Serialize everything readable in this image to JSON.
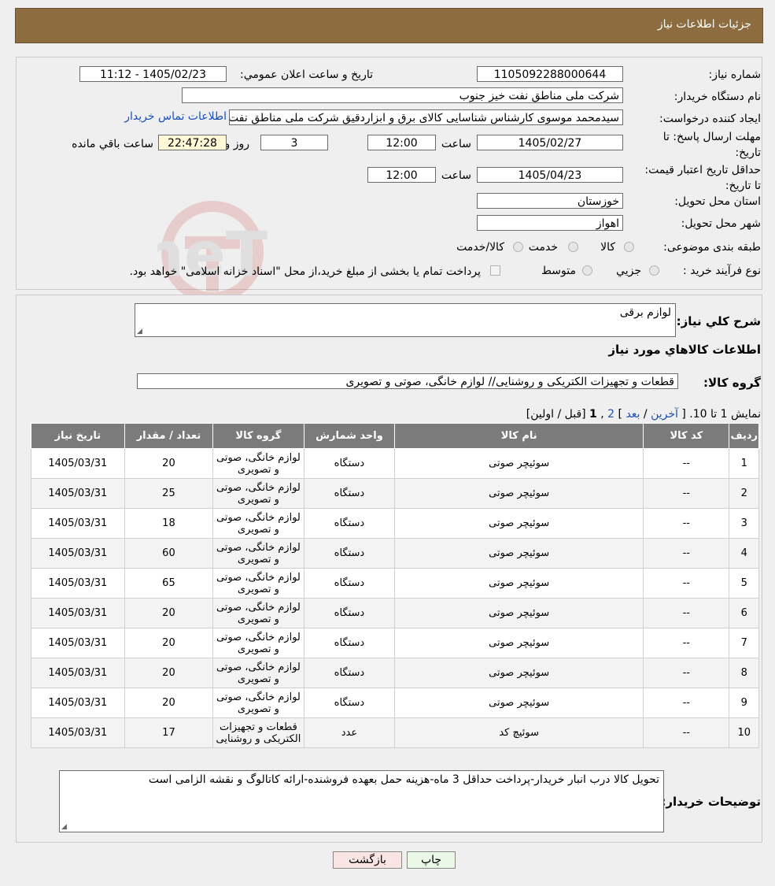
{
  "header": {
    "title": "جزئیات اطلاعات نیاز"
  },
  "form": {
    "need_number_label": "شماره نیاز:",
    "need_number": "1105092288000644",
    "announce_label": "تاريخ و ساعت اعلان عمومي:",
    "announce_value": "1405/02/23 - 11:12",
    "buyer_org_label": "نام دستگاه خريدار:",
    "buyer_org": "شرکت ملی مناطق نفت خیز جنوب",
    "creator_label": "ايجاد کننده درخواست:",
    "creator": "سیدمحمد موسوی کارشناس شناسایی کالای برق و ابزاردقیق شرکت ملی مناطق نفت خیز جنوب",
    "contact_link": "اطلاعات تماس خریدار",
    "reply_deadline_label": "مهلت ارسال پاسخ: تا تاريخ:",
    "reply_date": "1405/02/27",
    "time_label": "ساعت",
    "reply_time": "12:00",
    "days": "3",
    "days_label": "روز و",
    "remaining_time": "22:47:28",
    "remaining_label": "ساعت باقي مانده",
    "price_validity_label": "حداقل تاريخ اعتبار قيمت: تا تاريخ:",
    "price_date": "1405/04/23",
    "price_time": "12:00",
    "province_label": "استان محل تحويل:",
    "province": "خوزستان",
    "city_label": "شهر محل تحويل:",
    "city": "اهواز",
    "category_label": "طبقه بندی موضوعی:",
    "category_options": [
      "کالا",
      "خدمت",
      "کالا/خدمت"
    ],
    "process_label": "نوع فرآيند خريد :",
    "process_options": [
      "جزيي",
      "متوسط"
    ],
    "payment_note": "پرداخت تمام يا بخشی از مبلغ خريد،از محل \"اسناد خزانه اسلامی\" خواهد بود."
  },
  "watermark_text": "AriaTender.neT",
  "details": {
    "summary_label": "شرح كلي نياز:",
    "summary": "لوازم برقی",
    "goods_info_title": "اطلاعات کالاهاي مورد نياز",
    "group_label": "گروه کالا:",
    "group_value": "قطعات و تجهیزات الکتریکی و روشنایی// لوازم خانگی، صوتی و تصویری",
    "pagination": {
      "showing": "نمایش 1 تا 10.",
      "open": "[",
      "last": "آخرین",
      "sep1": "/",
      "next": "بعد",
      "close_part": "]",
      "page2": "2",
      "comma": ",",
      "page1": "1",
      "tail": "[قبل / اولین]"
    },
    "columns": [
      "رديف",
      "کد کالا",
      "نام کالا",
      "واحد شمارش",
      "گروه کالا",
      "تعداد / مقدار",
      "تاريخ نياز"
    ],
    "rows": [
      [
        "1",
        "--",
        "سوئیچر صوتی",
        "دستگاه",
        "لوازم خانگی، صوتی و تصویری",
        "20",
        "1405/03/31"
      ],
      [
        "2",
        "--",
        "سوئیچر صوتی",
        "دستگاه",
        "لوازم خانگی، صوتی و تصویری",
        "25",
        "1405/03/31"
      ],
      [
        "3",
        "--",
        "سوئیچر صوتی",
        "دستگاه",
        "لوازم خانگی، صوتی و تصویری",
        "18",
        "1405/03/31"
      ],
      [
        "4",
        "--",
        "سوئیچر صوتی",
        "دستگاه",
        "لوازم خانگی، صوتی و تصویری",
        "60",
        "1405/03/31"
      ],
      [
        "5",
        "--",
        "سوئیچر صوتی",
        "دستگاه",
        "لوازم خانگی، صوتی و تصویری",
        "65",
        "1405/03/31"
      ],
      [
        "6",
        "--",
        "سوئیچر صوتی",
        "دستگاه",
        "لوازم خانگی، صوتی و تصویری",
        "20",
        "1405/03/31"
      ],
      [
        "7",
        "--",
        "سوئیچر صوتی",
        "دستگاه",
        "لوازم خانگی، صوتی و تصویری",
        "20",
        "1405/03/31"
      ],
      [
        "8",
        "--",
        "سوئیچر صوتی",
        "دستگاه",
        "لوازم خانگی، صوتی و تصویری",
        "20",
        "1405/03/31"
      ],
      [
        "9",
        "--",
        "سوئیچر صوتی",
        "دستگاه",
        "لوازم خانگی، صوتی و تصویری",
        "20",
        "1405/03/31"
      ],
      [
        "10",
        "--",
        "سوئیچ کد",
        "عدد",
        "قطعات و تجهیزات الکتریکی و روشنایی",
        "17",
        "1405/03/31"
      ]
    ],
    "buyer_notes_label": "توضيحات خريدار:",
    "buyer_notes": "تحویل کالا درب انبار خریدار-پرداخت حداقل 3 ماه-هزینه حمل بعهده فروشنده-ارائه کاتالوگ و نقشه الزامی است"
  },
  "buttons": {
    "print": "چاپ",
    "back": "بازگشت"
  }
}
